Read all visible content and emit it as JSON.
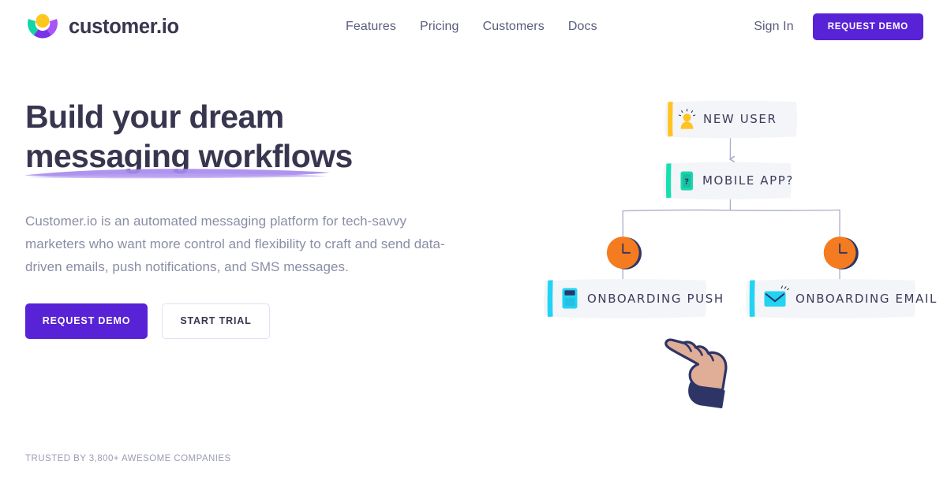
{
  "brand": {
    "name": "customer.io",
    "logo_icon": "customerio-logo-icon",
    "colors": {
      "logo_yellow": "#FFC61E",
      "logo_teal": "#12D6A6",
      "logo_purple_light": "#A855F7",
      "logo_purple": "#7A33E8"
    }
  },
  "header": {
    "nav": [
      {
        "label": "Features"
      },
      {
        "label": "Pricing"
      },
      {
        "label": "Customers"
      },
      {
        "label": "Docs"
      }
    ],
    "sign_in_label": "Sign In",
    "request_demo_label": "REQUEST DEMO"
  },
  "hero": {
    "headline_line1": "Build your dream",
    "headline_line2": "messaging workflows",
    "subhead": "Customer.io is an automated messaging platform for tech-savvy marketers who want more control and flexibility to craft and send data-driven emails, push notifications, and SMS messages.",
    "primary_cta": "REQUEST DEMO",
    "secondary_cta": "START TRIAL",
    "underline_color": "#A78BEE",
    "headline_color": "#38364F",
    "primary_cta_color": "#5822D6"
  },
  "trusted": {
    "text": "TRUSTED BY 3,800+ AWESOME COMPANIES"
  },
  "workflow": {
    "nodes": [
      {
        "id": "new-user",
        "label": "NEW USER",
        "icon": "new-user-person-icon",
        "accent_color": "#FFC422",
        "icon_color": "#FFC422"
      },
      {
        "id": "mobile-app",
        "label": "MOBILE APP?",
        "icon": "mobile-phone-question-icon",
        "accent_color": "#17E0B0",
        "icon_color": "#17D9AD"
      },
      {
        "id": "onboarding-push",
        "label": "ONBOARDING PUSH",
        "icon": "push-notification-phone-icon",
        "accent_color": "#22D3F3",
        "icon_color": "#22D3F3"
      },
      {
        "id": "onboarding-email",
        "label": "ONBOARDING EMAIL",
        "icon": "email-envelope-icon",
        "accent_color": "#22D3F3",
        "icon_color": "#22D3F3"
      }
    ],
    "timers": [
      {
        "id": "timer-left",
        "icon": "timer-clock-icon",
        "color": "#F47B20"
      },
      {
        "id": "timer-right",
        "icon": "timer-clock-icon",
        "color": "#F47B20"
      }
    ],
    "cursor": {
      "icon": "pointing-hand-cursor-icon",
      "skin_color": "#E0AE96",
      "cuff_color": "#2E3566"
    },
    "connector_color": "#A9ADC8",
    "node_bg": "#F4F5F8"
  }
}
